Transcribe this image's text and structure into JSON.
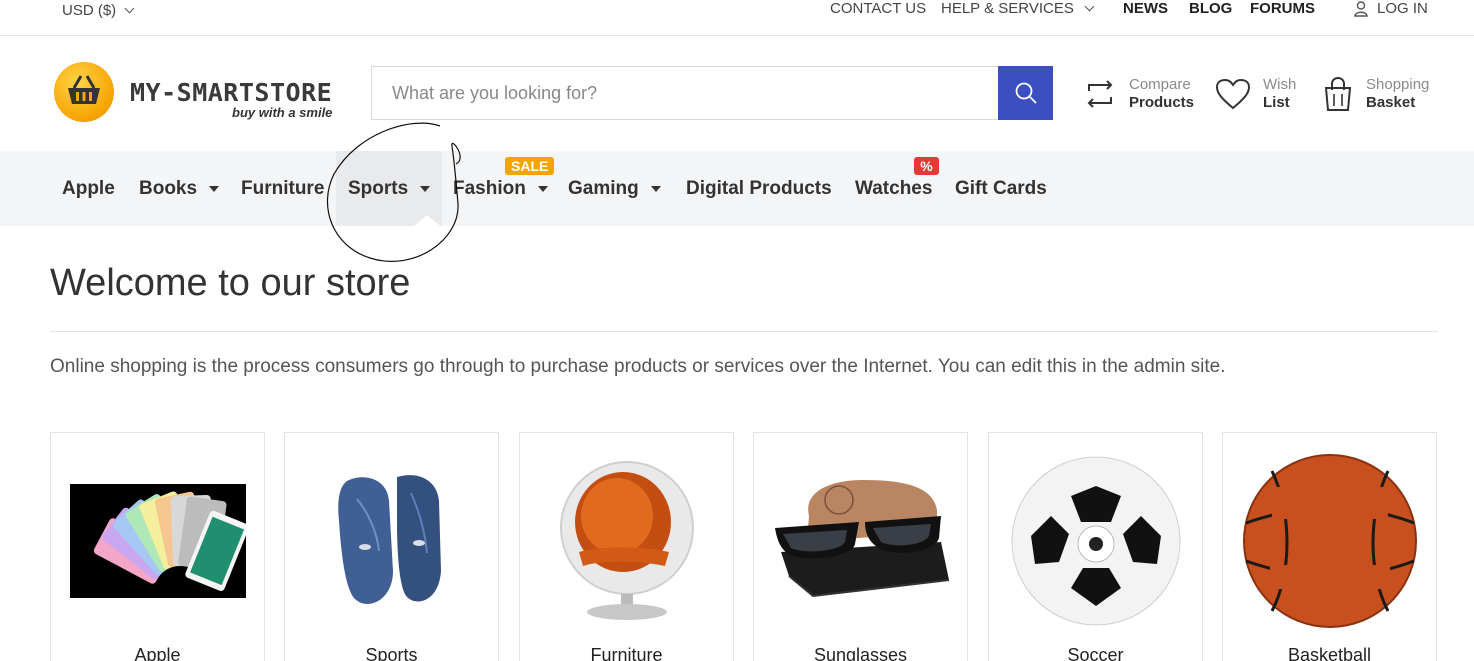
{
  "topbar": {
    "currency": "USD ($)",
    "contact": "CONTACT US",
    "help": "HELP & SERVICES",
    "news": "NEWS",
    "blog": "BLOG",
    "forums": "FORUMS",
    "login": "LOG IN"
  },
  "logo": {
    "title": "MY-SMARTSTORE",
    "tagline": "buy with a smile"
  },
  "search": {
    "placeholder": "What are you looking for?"
  },
  "header_tools": {
    "compare": {
      "line1": "Compare",
      "line2": "Products"
    },
    "wishlist": {
      "line1": "Wish",
      "line2": "List"
    },
    "basket": {
      "line1": "Shopping",
      "line2": "Basket"
    }
  },
  "nav": {
    "items": [
      {
        "label": "Apple"
      },
      {
        "label": "Books"
      },
      {
        "label": "Furniture"
      },
      {
        "label": "Sports"
      },
      {
        "label": "Fashion"
      },
      {
        "label": "Gaming"
      },
      {
        "label": "Digital Products"
      },
      {
        "label": "Watches"
      },
      {
        "label": "Gift Cards"
      }
    ],
    "sale_badge": "SALE",
    "percent_badge": "%"
  },
  "main": {
    "title": "Welcome to our store",
    "intro": "Online shopping is the process consumers go through to purchase products or services over the Internet. You can edit this in the admin site."
  },
  "categories": [
    {
      "label": "Apple"
    },
    {
      "label": "Sports"
    },
    {
      "label": "Furniture"
    },
    {
      "label": "Sunglasses"
    },
    {
      "label": "Soccer"
    },
    {
      "label": "Basketball"
    }
  ],
  "colors": {
    "accent": "#3c4fc1",
    "sale": "#f0a500",
    "percent": "#e53935"
  }
}
